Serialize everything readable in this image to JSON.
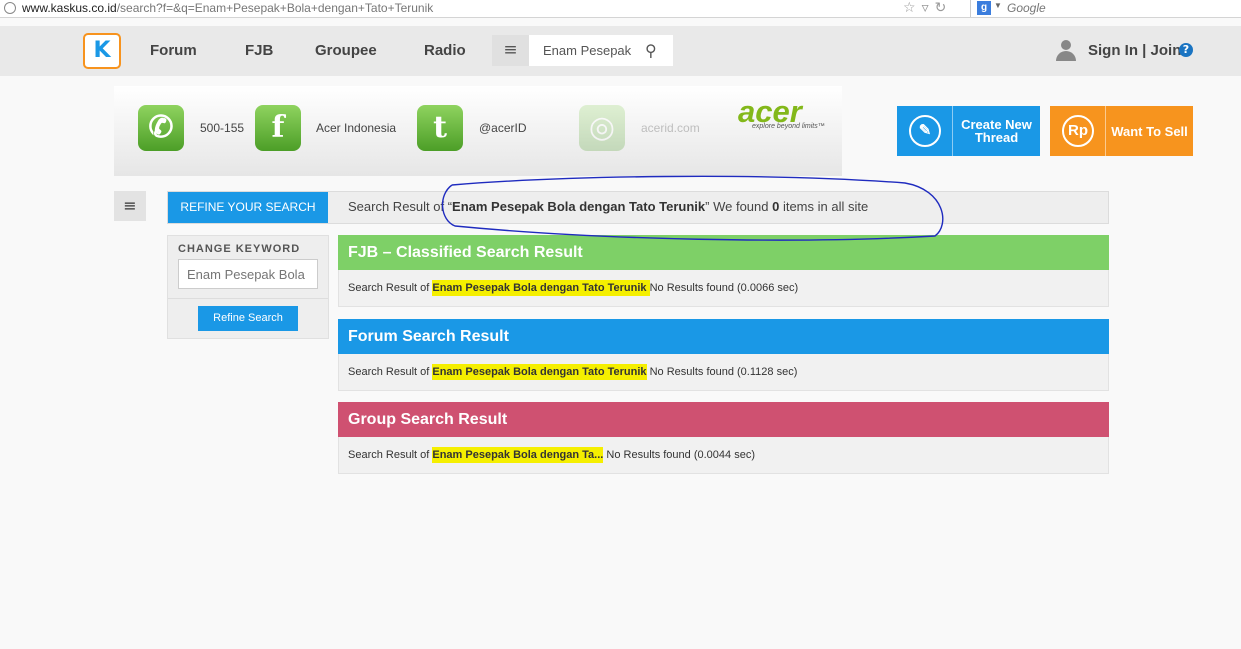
{
  "browser": {
    "url_host": "www.kaskus.co.id",
    "url_path": "/search?f=&q=Enam+Pesepak+Bola+dengan+Tato+Terunik",
    "search_engine": "Google",
    "icons": [
      "star-icon",
      "dropdown-arrow-icon",
      "reload-icon"
    ]
  },
  "nav": {
    "logo": "K",
    "links": [
      "Forum",
      "FJB",
      "Groupee",
      "Radio"
    ],
    "search_value": "Enam Pesepak",
    "signin": "Sign In | Join",
    "help": "?"
  },
  "banner": {
    "phone": "500-155",
    "facebook": "Acer Indonesia",
    "twitter": "@acerID",
    "site": "acerid.com",
    "brand": "acer",
    "tagline": "explore beyond limits™",
    "icon_letters": {
      "facebook": "f",
      "twitter": "t"
    }
  },
  "buttons": {
    "create_line1": "Create New",
    "create_line2": "Thread",
    "sell": "Want To Sell",
    "sell_icon": "Rp"
  },
  "refine": {
    "tab": "REFINE YOUR SEARCH",
    "prefix": "Search Result of “",
    "query": "Enam Pesepak Bola dengan Tato Terunik",
    "mid": "” We found ",
    "count": "0",
    "suffix": " items in all site"
  },
  "keyword": {
    "title": "CHANGE KEYWORD",
    "placeholder": "Enam Pesepak Bola",
    "button": "Refine Search"
  },
  "results": [
    {
      "title": "FJB – Classified Search Result",
      "prefix": "Search Result of ",
      "query": "Enam Pesepak Bola dengan Tato Terunik ",
      "status": " No Results found (0.0066 sec)"
    },
    {
      "title": "Forum Search Result",
      "prefix": "Search Result of ",
      "query": "Enam Pesepak Bola dengan Tato Terunik",
      "status": " No Results found (0.1128 sec)"
    },
    {
      "title": "Group Search Result",
      "prefix": "Search Result of ",
      "query": "Enam Pesepak Bola dengan Ta...",
      "status": " No Results found (0.0044 sec)"
    }
  ],
  "colors": {
    "accent_blue": "#1a98e6",
    "sell_orange": "#f7941e",
    "fjb_green": "#7ed067",
    "group_pink": "#cf5171",
    "highlight_yellow": "#f5ef00",
    "annotation_ink": "#1f2bbf"
  }
}
